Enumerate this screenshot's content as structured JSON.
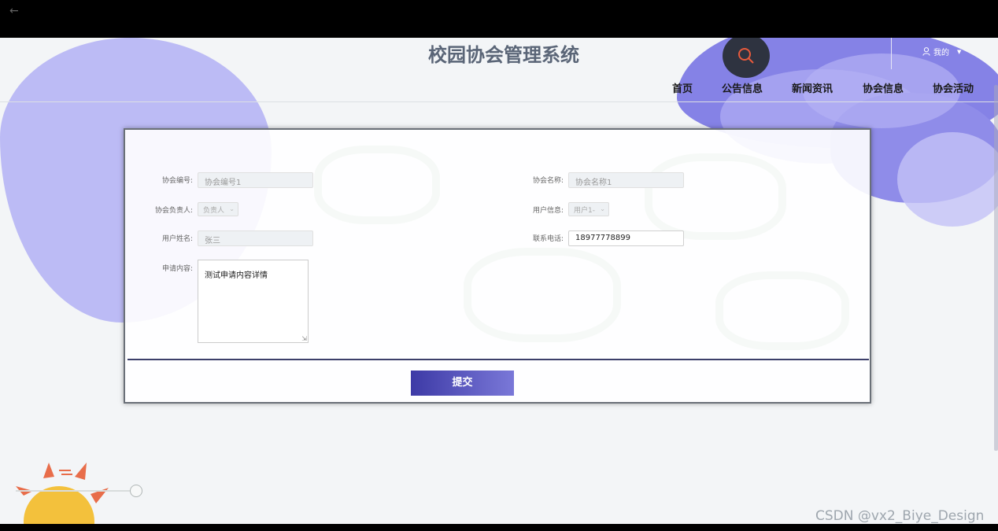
{
  "app": {
    "title": "校园协会管理系统",
    "user_menu_label": "我的"
  },
  "nav": {
    "items": [
      {
        "label": "首页"
      },
      {
        "label": "公告信息"
      },
      {
        "label": "新闻资讯"
      },
      {
        "label": "协会信息"
      },
      {
        "label": "协会活动"
      }
    ]
  },
  "form": {
    "association_id": {
      "label": "协会编号:",
      "value": "协会编号1"
    },
    "association_name": {
      "label": "协会名称:",
      "value": "协会名称1"
    },
    "leader": {
      "label": "协会负责人:",
      "value": "负责人"
    },
    "user_info": {
      "label": "用户信息:",
      "value": "用户1-"
    },
    "user_name": {
      "label": "用户姓名:",
      "value": "张三"
    },
    "phone": {
      "label": "联系电话:",
      "value": "18977778899"
    },
    "application": {
      "label": "申请内容:",
      "value": "测试申请内容详情"
    },
    "submit_label": "提交"
  },
  "watermark": "CSDN @vx2_Biye_Design",
  "colors": {
    "accent": "#4a48b8",
    "blob": "#9d9bef",
    "search_bg": "#2e3340",
    "search_icon": "#e85a3c"
  }
}
